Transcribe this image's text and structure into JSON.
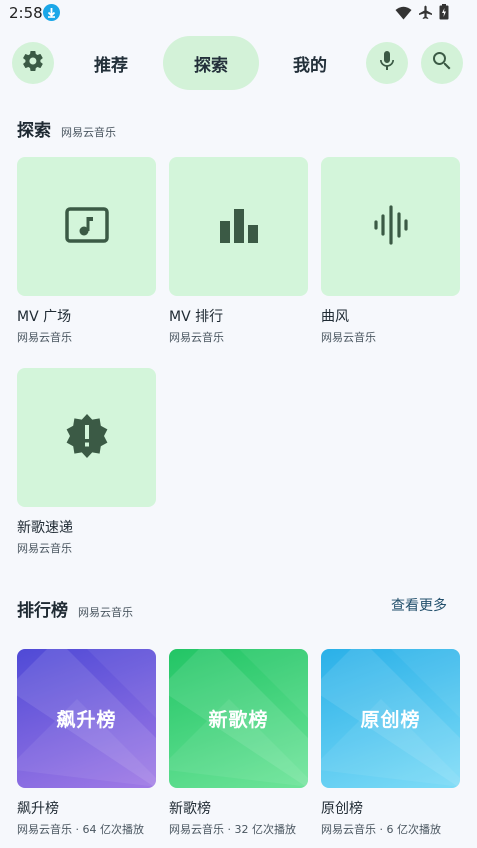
{
  "status_bar": {
    "time": "2:58"
  },
  "nav": {
    "tabs": [
      {
        "label": "推荐"
      },
      {
        "label": "探索"
      },
      {
        "label": "我的"
      }
    ]
  },
  "explore": {
    "title": "探索",
    "subtitle": "网易云音乐",
    "items": [
      {
        "title": "MV 广场",
        "subtitle": "网易云音乐",
        "icon": "music-video-icon"
      },
      {
        "title": "MV 排行",
        "subtitle": "网易云音乐",
        "icon": "bar-chart-icon"
      },
      {
        "title": "曲风",
        "subtitle": "网易云音乐",
        "icon": "sound-wave-icon"
      },
      {
        "title": "新歌速递",
        "subtitle": "网易云音乐",
        "icon": "new-release-icon"
      }
    ]
  },
  "charts": {
    "title": "排行榜",
    "subtitle": "网易云音乐",
    "more_label": "查看更多",
    "items": [
      {
        "cover_label": "飙升榜",
        "title": "飙升榜",
        "subtitle": "网易云音乐 · 64 亿次播放",
        "gradient": [
          "#4f4ad6",
          "#a07ae6"
        ]
      },
      {
        "cover_label": "新歌榜",
        "title": "新歌榜",
        "subtitle": "网易云音乐 · 32 亿次播放",
        "gradient": [
          "#22c565",
          "#6ee49a"
        ]
      },
      {
        "cover_label": "原创榜",
        "title": "原创榜",
        "subtitle": "网易云音乐 · 6 亿次播放",
        "gradient": [
          "#2ab0e8",
          "#7edcf7"
        ]
      }
    ]
  },
  "colors": {
    "accent_bg": "#d3f2d8",
    "icon_dark": "#3b5a45",
    "background": "#f6f8fc"
  }
}
